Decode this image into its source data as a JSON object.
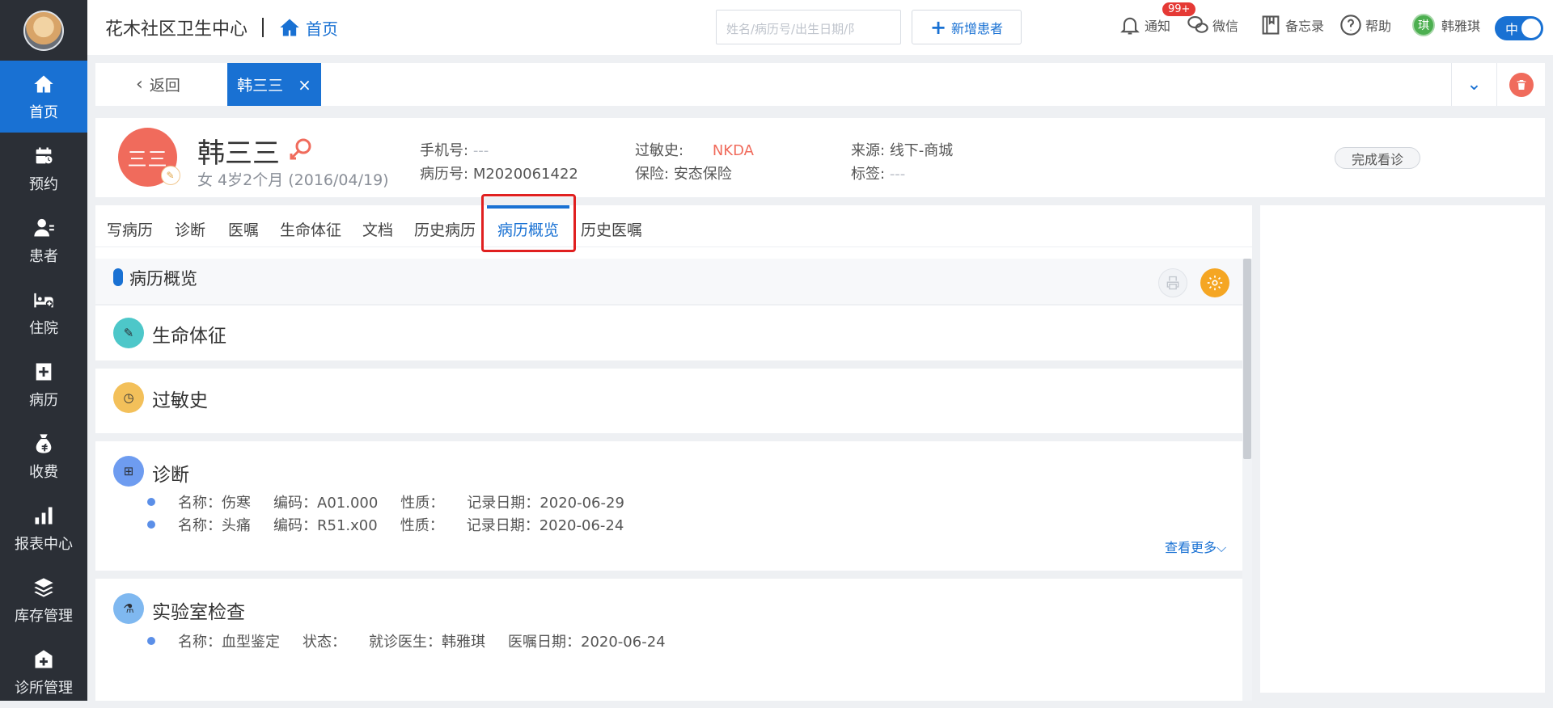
{
  "sidebar": {
    "items": [
      {
        "label": "首页",
        "icon": "home-icon",
        "active": true
      },
      {
        "label": "预约",
        "icon": "calendar-icon",
        "active": false
      },
      {
        "label": "患者",
        "icon": "patient-icon",
        "active": false
      },
      {
        "label": "住院",
        "icon": "bed-icon",
        "active": false
      },
      {
        "label": "病历",
        "icon": "medical-record-icon",
        "active": false
      },
      {
        "label": "收费",
        "icon": "money-bag-icon",
        "active": false
      },
      {
        "label": "报表中心",
        "icon": "bar-chart-icon",
        "active": false
      },
      {
        "label": "库存管理",
        "icon": "layers-icon",
        "active": false
      },
      {
        "label": "诊所管理",
        "icon": "clinic-icon",
        "active": false
      }
    ]
  },
  "topbar": {
    "clinic_name": "花木社区卫生中心",
    "home_label": "首页",
    "search_placeholder": "姓名/病历号/出生日期/阝",
    "new_patient_label": "新增患者",
    "notify_label": "通知",
    "notify_badge": "99+",
    "wechat_label": "微信",
    "memo_label": "备忘录",
    "help_label": "帮助",
    "user_avatar_text": "琪",
    "user_name": "韩雅琪",
    "lang_label": "中"
  },
  "tabstrip": {
    "back_label": "返回",
    "patient_tab_label": "韩三三",
    "close_glyph": "×",
    "collapse_glyph": "⌄"
  },
  "patient": {
    "avatar_text": "三三",
    "name": "韩三三",
    "sub": "女  4岁2个月  (2016/04/19)",
    "phone_label": "手机号:",
    "phone_value": "---",
    "record_label": "病历号:",
    "record_value": "M2020061422",
    "allergy_label": "过敏史:",
    "allergy_value": "NKDA",
    "insurance_label": "保险:",
    "insurance_value": "安态保险",
    "source_label": "来源:",
    "source_value": "线下-商城",
    "tag_label": "标签:",
    "tag_value": "---",
    "finish_label": "完成看诊"
  },
  "tabs": [
    {
      "label": "写病历",
      "active": false
    },
    {
      "label": "诊断",
      "active": false
    },
    {
      "label": "医嘱",
      "active": false
    },
    {
      "label": "生命体征",
      "active": false
    },
    {
      "label": "文档",
      "active": false
    },
    {
      "label": "历史病历",
      "active": false
    },
    {
      "label": "病历概览",
      "active": true
    },
    {
      "label": "历史医嘱",
      "active": false
    }
  ],
  "overview": {
    "title": "病历概览",
    "sections": {
      "vitals": {
        "title": "生命体征",
        "icon_color": "#4dc7c9"
      },
      "allergy": {
        "title": "过敏史",
        "icon_color": "#f3c05a"
      },
      "diagnosis": {
        "title": "诊断",
        "icon_color": "#6e9cf0",
        "rows": [
          {
            "name": "名称：伤寒",
            "code": "编码：A01.000",
            "nature": "性质：",
            "date": "记录日期：2020-06-29"
          },
          {
            "name": "名称：头痛",
            "code": "编码：R51.x00",
            "nature": "性质：",
            "date": "记录日期：2020-06-24"
          }
        ],
        "more_label": "查看更多⌵"
      },
      "lab": {
        "title": "实验室检查",
        "icon_color": "#7fb8f0",
        "rows": [
          {
            "name": "名称：血型鉴定",
            "status": "状态：",
            "doctor": "就诊医生：韩雅琪",
            "date": "医嘱日期：2020-06-24"
          }
        ]
      }
    }
  },
  "colors": {
    "primary": "#1971d3",
    "sidebar_bg": "#2b2f36",
    "danger": "#f06b5c",
    "highlight": "#e02020",
    "gear": "#f5a623"
  }
}
